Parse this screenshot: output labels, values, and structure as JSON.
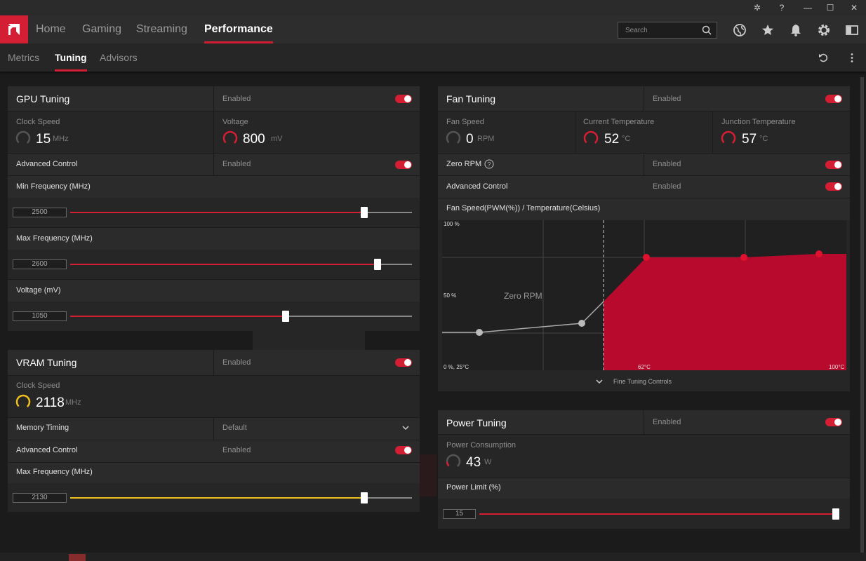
{
  "nav": {
    "tabs": [
      "Home",
      "Gaming",
      "Streaming",
      "Performance"
    ],
    "search_placeholder": "Search"
  },
  "subnav": {
    "tabs": [
      "Metrics",
      "Tuning",
      "Advisors"
    ]
  },
  "gpu": {
    "title": "GPU Tuning",
    "status": "Enabled",
    "clock_label": "Clock Speed",
    "clock_value": "15",
    "clock_unit": "MHz",
    "voltage_label": "Voltage",
    "voltage_value": "800",
    "voltage_unit": "mV",
    "advanced_label": "Advanced Control",
    "advanced_status": "Enabled",
    "min_freq_label": "Min Frequency (MHz)",
    "min_freq_value": "2500",
    "max_freq_label": "Max Frequency (MHz)",
    "max_freq_value": "2600",
    "volt_slider_label": "Voltage (mV)",
    "volt_slider_value": "1050"
  },
  "vram": {
    "title": "VRAM Tuning",
    "status": "Enabled",
    "clock_label": "Clock Speed",
    "clock_value": "2118",
    "clock_unit": "MHz",
    "timing_label": "Memory Timing",
    "timing_value": "Default",
    "advanced_label": "Advanced Control",
    "advanced_status": "Enabled",
    "max_freq_label": "Max Frequency (MHz)",
    "max_freq_value": "2130"
  },
  "fan": {
    "title": "Fan Tuning",
    "status": "Enabled",
    "speed_label": "Fan Speed",
    "speed_value": "0",
    "speed_unit": "RPM",
    "cur_temp_label": "Current Temperature",
    "cur_temp_value": "52",
    "cur_temp_unit": "°C",
    "junc_temp_label": "Junction Temperature",
    "junc_temp_value": "57",
    "junc_temp_unit": "°C",
    "zero_rpm_label": "Zero RPM",
    "zero_rpm_status": "Enabled",
    "advanced_label": "Advanced Control",
    "advanced_status": "Enabled",
    "curve_label": "Fan Speed(PWM(%)) / Temperature(Celsius)",
    "chart": {
      "y_top": "100 %",
      "y_mid": "50 %",
      "origin": "0 %, 25°C",
      "x_mid": "62°C",
      "x_end": "100°C",
      "zero_rpm_text": "Zero RPM"
    },
    "fine_tuning": "Fine Tuning Controls"
  },
  "power": {
    "title": "Power Tuning",
    "status": "Enabled",
    "consumption_label": "Power Consumption",
    "consumption_value": "43",
    "consumption_unit": "W",
    "limit_label": "Power Limit (%)",
    "limit_value": "15"
  },
  "colors": {
    "accent": "#d41e34",
    "vram_accent": "#f0c01e",
    "panel": "#262626"
  },
  "sliders": {
    "gpu_min_freq_pct": 86,
    "gpu_max_freq_pct": 90,
    "gpu_voltage_pct": 63,
    "vram_max_freq_pct": 86,
    "power_limit_pct": 100
  }
}
